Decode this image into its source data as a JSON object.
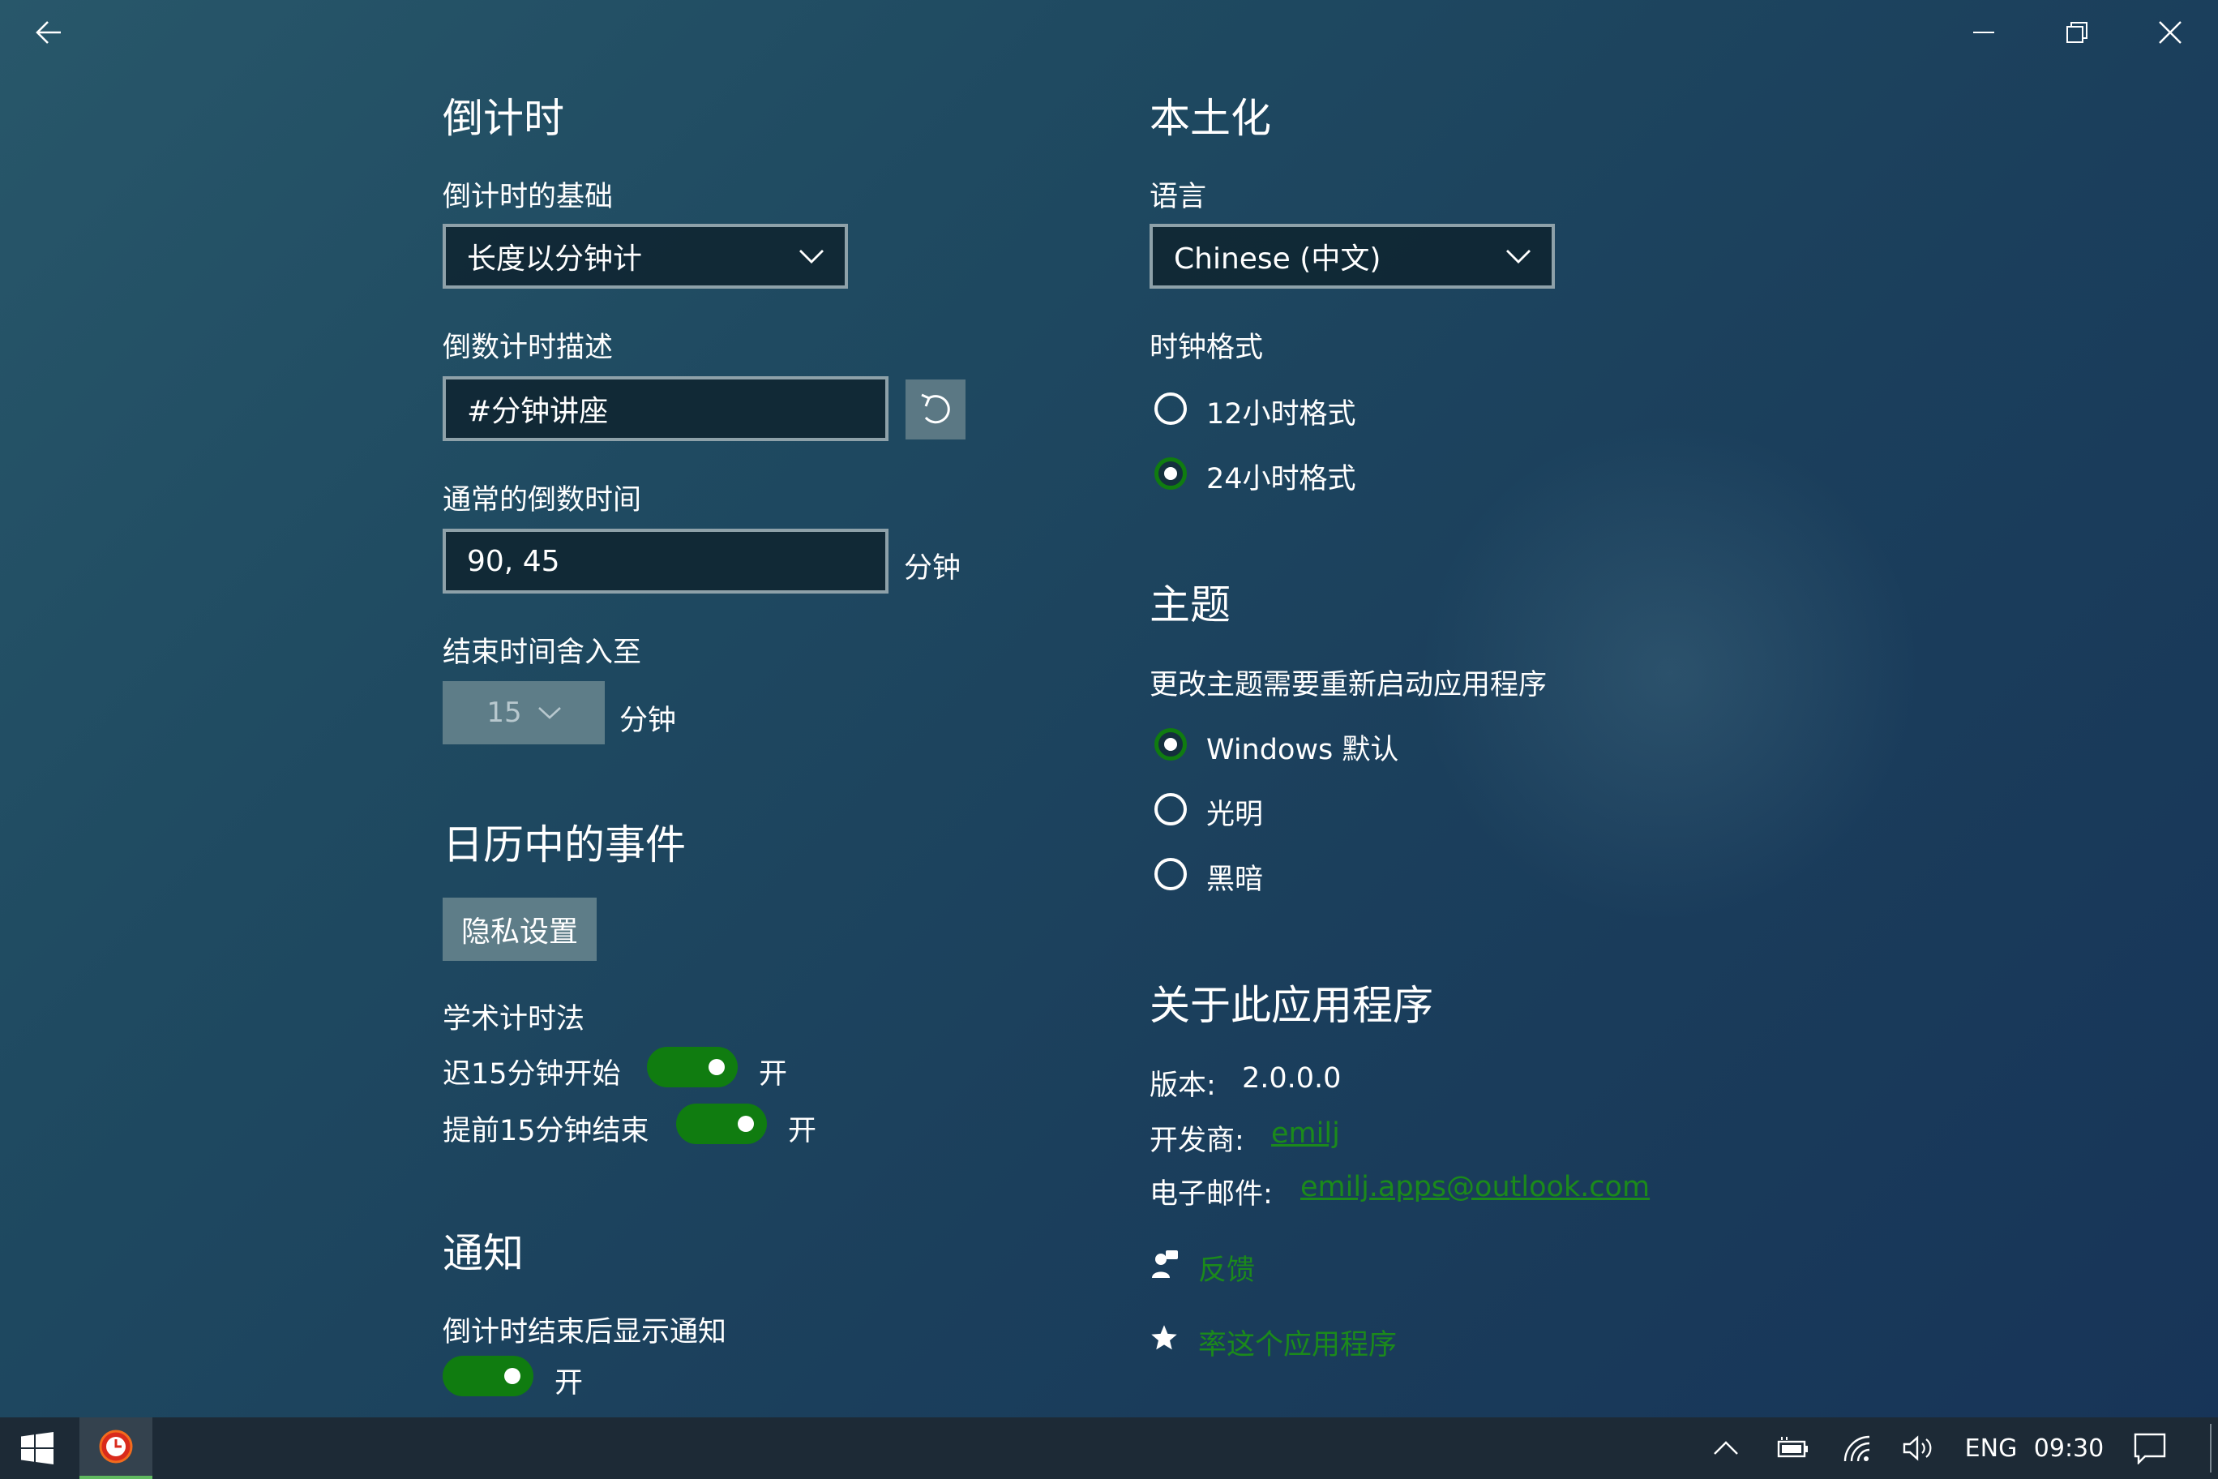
{
  "titlebar": {
    "back_icon": "back-arrow-icon",
    "minimize_icon": "minimize-icon",
    "maximize_icon": "restore-icon",
    "close_icon": "close-icon"
  },
  "countdown": {
    "heading": "倒计时",
    "basis_label": "倒计时的基础",
    "basis_value": "长度以分钟计",
    "description_label": "倒数计时描述",
    "description_value": "#分钟讲座",
    "usual_times_label": "通常的倒数时间",
    "usual_times_value": "90, 45",
    "usual_times_unit": "分钟",
    "round_end_label": "结束时间舍入至",
    "round_end_value": "15",
    "round_end_unit": "分钟"
  },
  "calendar": {
    "heading": "日历中的事件",
    "privacy_button": "隐私设置",
    "academic_label": "学术计时法",
    "late_start_label": "迟15分钟开始",
    "late_start_state": "开",
    "early_end_label": "提前15分钟结束",
    "early_end_state": "开"
  },
  "notifications": {
    "heading": "通知",
    "show_label": "倒计时结束后显示通知",
    "show_state": "开"
  },
  "localization": {
    "heading": "本土化",
    "language_label": "语言",
    "language_value": "Chinese (中文)",
    "clock_format_label": "时钟格式",
    "clock_12h": "12小时格式",
    "clock_24h": "24小时格式",
    "clock_selected": "24h"
  },
  "theme": {
    "heading": "主题",
    "note": "更改主题需要重新启动应用程序",
    "windows_default": "Windows 默认",
    "light": "光明",
    "dark": "黑暗",
    "selected": "windows_default"
  },
  "about": {
    "heading": "关于此应用程序",
    "version_label": "版本:",
    "version_value": "2.0.0.0",
    "developer_label": "开发商:",
    "developer_value": "emilj",
    "email_label": "电子邮件:",
    "email_value": "emilj.apps@outlook.com",
    "feedback_label": "反馈",
    "feedback_icon": "feedback-person-icon",
    "rate_label": "率这个应用程序",
    "rate_icon": "star-icon"
  },
  "taskbar": {
    "start_icon": "windows-logo-icon",
    "app_icon": "countdown-app-icon",
    "chevron_icon": "chevron-up-icon",
    "battery_icon": "battery-icon",
    "wifi_icon": "wifi-icon",
    "volume_icon": "volume-icon",
    "language": "ENG",
    "time": "09:30",
    "notification_icon": "action-center-icon"
  },
  "colors": {
    "accent": "#107c10",
    "link": "#1b8a1b",
    "background": "#1f4a61"
  }
}
